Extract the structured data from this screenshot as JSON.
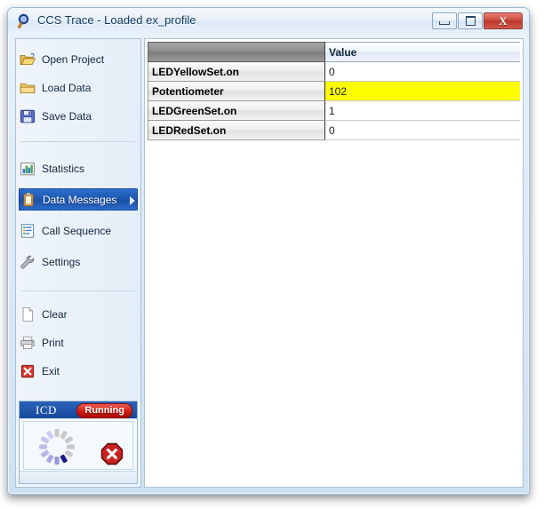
{
  "window": {
    "title": "CCS Trace - Loaded ex_profile",
    "app_icon": "magnifier-icon",
    "controls": {
      "minimize": "minimize-icon",
      "maximize": "maximize-icon",
      "close": "X"
    }
  },
  "sidebar": {
    "groups": [
      {
        "items": [
          {
            "label": "Open Project",
            "icon": "open-folder-icon",
            "selected": false
          },
          {
            "label": "Load Data",
            "icon": "folder-icon",
            "selected": false
          },
          {
            "label": "Save Data",
            "icon": "floppy-disk-icon",
            "selected": false
          }
        ]
      },
      {
        "items": [
          {
            "label": "Statistics",
            "icon": "bar-chart-icon",
            "selected": false
          },
          {
            "label": "Data Messages",
            "icon": "clipboard-icon",
            "selected": true
          },
          {
            "label": "Call Sequence",
            "icon": "list-icon",
            "selected": false
          },
          {
            "label": "Settings",
            "icon": "wrench-icon",
            "selected": false
          }
        ]
      },
      {
        "items": [
          {
            "label": "Clear",
            "icon": "blank-page-icon",
            "selected": false
          },
          {
            "label": "Print",
            "icon": "printer-icon",
            "selected": false
          },
          {
            "label": "Exit",
            "icon": "red-x-icon",
            "selected": false
          }
        ]
      }
    ]
  },
  "icd_panel": {
    "title": "ICD",
    "status_badge": "Running",
    "spinner_icon": "loading-spinner-icon",
    "stop_icon": "stop-button-icon",
    "colors": {
      "header_blue": "#17489c",
      "badge_red": "#d11a10",
      "spinner_active": "#1a1a8c",
      "spinner_trail": "#b0b0e0",
      "spinner_idle": "#c8c8c8"
    }
  },
  "table": {
    "columns": [
      "",
      "Value"
    ],
    "rows": [
      {
        "name": "LEDYellowSet.on",
        "value": "0",
        "highlighted": false
      },
      {
        "name": "Potentiometer",
        "value": "102",
        "highlighted": true
      },
      {
        "name": "LEDGreenSet.on",
        "value": "1",
        "highlighted": false
      },
      {
        "name": "LEDRedSet.on",
        "value": "0",
        "highlighted": false
      }
    ],
    "highlight_color": "#ffff00"
  }
}
